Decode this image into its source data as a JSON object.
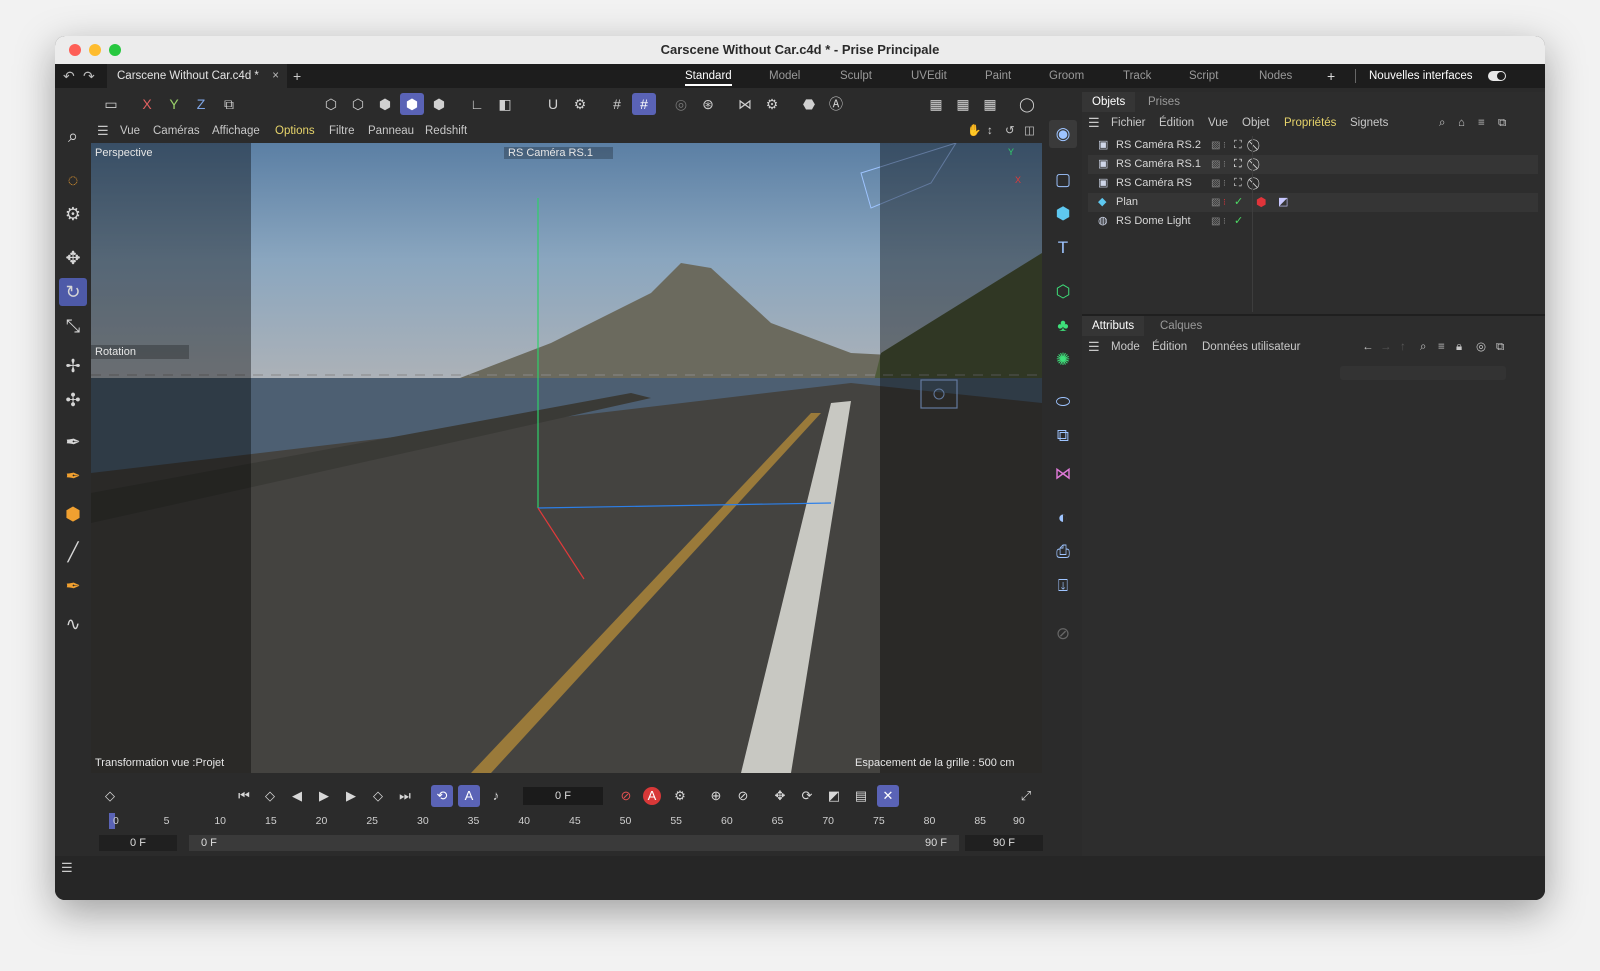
{
  "window": {
    "title": "Carscene Without Car.c4d * - Prise Principale"
  },
  "tabbar": {
    "document_tab": "Carscene Without Car.c4d *",
    "close_glyph": "×",
    "add_glyph": "+",
    "workspaces": [
      "Standard",
      "Model",
      "Sculpt",
      "UVEdit",
      "Paint",
      "Groom",
      "Track",
      "Script",
      "Nodes"
    ],
    "active_workspace": "Standard",
    "new_interfaces": "Nouvelles interfaces"
  },
  "toolbar": {
    "axis_x": "X",
    "axis_y": "Y",
    "axis_z": "Z"
  },
  "viewport": {
    "menu": [
      "Vue",
      "Caméras",
      "Affichage",
      "Options",
      "Filtre",
      "Panneau",
      "Redshift"
    ],
    "highlighted_menu": "Options",
    "projection_label": "Perspective",
    "camera_label": "RS Caméra RS.1",
    "tool_label": "Rotation",
    "transform_label": "Transformation vue :Projet",
    "grid_label": "Espacement de la grille : 500 cm",
    "axis_y": "Y",
    "axis_x": "X"
  },
  "timeline": {
    "current_frame": "0 F",
    "ruler_ticks": [
      "0",
      "5",
      "10",
      "15",
      "20",
      "25",
      "30",
      "35",
      "40",
      "45",
      "50",
      "55",
      "60",
      "65",
      "70",
      "75",
      "80",
      "85",
      "90"
    ],
    "start_field": "0 F",
    "preview_start": "0 F",
    "preview_end": "90 F",
    "end_field": "90 F",
    "auto_key_label": "A"
  },
  "objects_panel": {
    "tabs": [
      "Objets",
      "Prises"
    ],
    "menu": [
      "Fichier",
      "Édition",
      "Vue",
      "Objet",
      "Propriétés",
      "Signets"
    ],
    "highlighted_menu": "Propriétés",
    "items": [
      {
        "name": "RS Caméra RS.2",
        "icon": "camera-icon"
      },
      {
        "name": "RS Caméra RS.1",
        "icon": "camera-icon"
      },
      {
        "name": "RS Caméra RS",
        "icon": "camera-icon"
      },
      {
        "name": "Plan",
        "icon": "plane-icon"
      },
      {
        "name": "RS Dome Light",
        "icon": "dome-light-icon"
      }
    ]
  },
  "attributes_panel": {
    "tabs": [
      "Attributs",
      "Calques"
    ],
    "menu": [
      "Mode",
      "Édition",
      "Données utilisateur"
    ]
  },
  "colors": {
    "accent": "#5a63b6",
    "highlight_menu": "#e6d36a",
    "check_green": "#4cd964",
    "red_tag": "#e0343a"
  }
}
